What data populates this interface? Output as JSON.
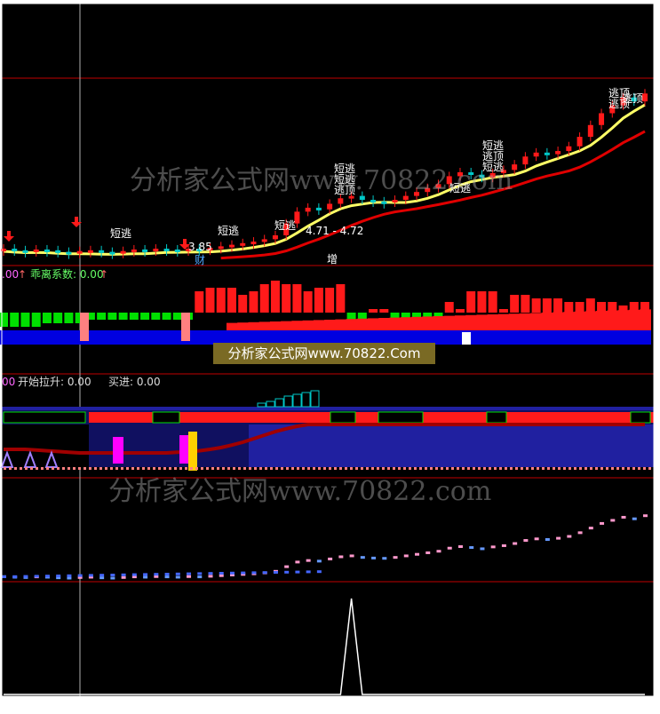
{
  "panel1": {
    "price_label": "4.71 - 4.72",
    "low_label": "3.85",
    "fin_mark": "财",
    "inc_mark": "增",
    "signals": [
      "短逃",
      "短逃",
      "短逃",
      "短逃",
      "短逃",
      "逃顶",
      "短逃",
      "短逃",
      "逃顶",
      "短逃",
      "逃顶",
      "逃顶",
      "逃顶"
    ]
  },
  "panel2": {
    "legend_prefix": ".00",
    "legend_name": "乖离系数: 0.00",
    "arrow": "↑"
  },
  "panel3": {
    "legend_prefix": "00",
    "legend_start": "开始拉升: 0.00",
    "legend_buy": "买进: 0.00"
  },
  "watermarks": {
    "top": "分析家公式网www.70822.com",
    "banner": "分析家公式网www.70822.Com",
    "bottom": "分析家公式网www.70822.com"
  },
  "colors": {
    "background": "#000000",
    "frame": "#ffffff",
    "separator": "#c00000",
    "up": "#ff1a1a",
    "down": "#00c8c8",
    "ma_yellow": "#ffff66",
    "ma_red": "#e00000",
    "bias_green": "#00e000",
    "blue_band": "#2020a0",
    "magenta": "#ff00ff",
    "cursor": "#b0b0b0"
  },
  "chart_data": [
    {
      "type": "line",
      "name": "price",
      "x_count": 60,
      "close": [
        3.88,
        3.86,
        3.85,
        3.87,
        3.86,
        3.84,
        3.83,
        3.85,
        3.86,
        3.84,
        3.83,
        3.85,
        3.87,
        3.86,
        3.88,
        3.87,
        3.86,
        3.88,
        3.87,
        3.89,
        3.91,
        3.93,
        3.95,
        3.97,
        4.0,
        4.05,
        4.2,
        4.35,
        4.4,
        4.38,
        4.45,
        4.52,
        4.55,
        4.5,
        4.48,
        4.47,
        4.5,
        4.55,
        4.6,
        4.65,
        4.7,
        4.8,
        4.85,
        4.82,
        4.78,
        4.84,
        4.88,
        4.95,
        5.05,
        5.1,
        5.08,
        5.12,
        5.18,
        5.3,
        5.45,
        5.6,
        5.7,
        5.8,
        5.75,
        5.85
      ],
      "annotations": [
        "4.71 - 4.72",
        "3.85"
      ]
    },
    {
      "type": "bar",
      "name": "乖离系数",
      "value_label": "0.00",
      "values": [
        -0.4,
        -0.4,
        -0.4,
        -0.4,
        -0.3,
        -0.3,
        -0.3,
        -0.3,
        -0.2,
        -0.2,
        -0.2,
        -0.2,
        -0.2,
        -0.2,
        -0.2,
        -0.2,
        -0.2,
        -0.2,
        0.6,
        0.7,
        0.7,
        0.7,
        0.5,
        0.6,
        0.8,
        0.9,
        0.8,
        0.8,
        0.6,
        0.7,
        0.7,
        0.8,
        -0.2,
        -0.2,
        0.1,
        0.1,
        -0.2,
        -0.2,
        -0.2,
        -0.2,
        -0.2,
        0.3,
        0.1,
        0.6,
        0.6,
        0.6,
        0.1,
        0.5,
        0.5,
        0.4,
        0.4,
        0.4,
        0.3,
        0.3,
        0.4,
        0.3,
        0.3,
        0.2,
        0.3,
        0.3
      ]
    },
    {
      "type": "line",
      "name": "开始拉升",
      "value_label": "0.00",
      "buy_label": "0.00",
      "trend": [
        0.3,
        0.3,
        0.3,
        0.28,
        0.26,
        0.24,
        0.22,
        0.2,
        0.2,
        0.2,
        0.2,
        0.2,
        0.2,
        0.2,
        0.2,
        0.2,
        0.22,
        0.24,
        0.26,
        0.3,
        0.35,
        0.42,
        0.5,
        0.6,
        0.7,
        0.8,
        0.88,
        0.95,
        1.0,
        1.0,
        1.0,
        1.0,
        1.0,
        1.0,
        1.0,
        1.0,
        1.0,
        1.0,
        1.0,
        1.0,
        1.0,
        1.0,
        1.0,
        1.0,
        1.0,
        1.0,
        1.0,
        1.0,
        1.0,
        1.0,
        1.0,
        1.0,
        1.0,
        1.0,
        1.0,
        1.0,
        1.0,
        1.0,
        1.0,
        1.0
      ]
    },
    {
      "type": "line",
      "name": "spike",
      "values": [
        0,
        0,
        0,
        0,
        0,
        0,
        0,
        0,
        0,
        0,
        0,
        0,
        0,
        0,
        0,
        0,
        0,
        0,
        0,
        0,
        0,
        0,
        0,
        0,
        0,
        0,
        0,
        0,
        0,
        0,
        0,
        0,
        1,
        0,
        0,
        0,
        0,
        0,
        0,
        0,
        0,
        0,
        0,
        0,
        0,
        0,
        0,
        0,
        0,
        0,
        0,
        0,
        0,
        0,
        0,
        0,
        0,
        0,
        0,
        0
      ]
    }
  ]
}
